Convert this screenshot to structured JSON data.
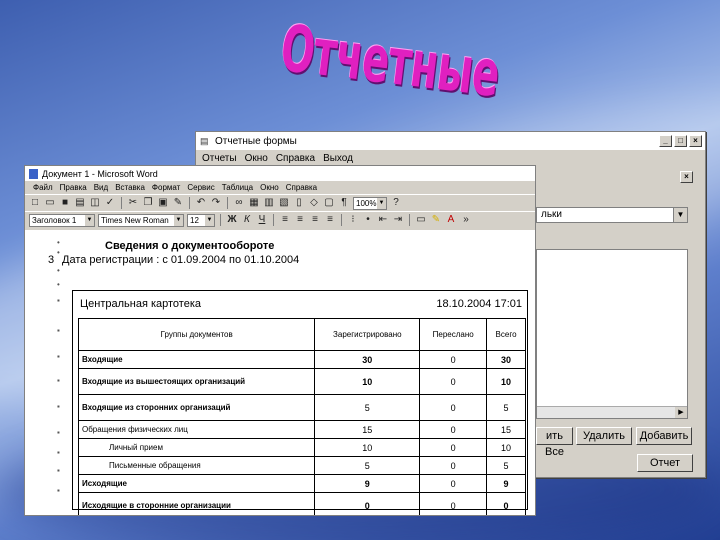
{
  "slide": {
    "title": "Отчетные формы"
  },
  "back_window": {
    "title": "Отчетные формы",
    "menu": [
      "Отчеты",
      "Окно",
      "Справка",
      "Выход"
    ],
    "combo_value": "льки",
    "buttons": {
      "save": "ить Все",
      "delete": "Удалить",
      "add": "Добавить",
      "report": "Отчет"
    }
  },
  "word_window": {
    "title": "Документ 1 - Microsoft Word",
    "menu": [
      "Файл",
      "Правка",
      "Вид",
      "Вставка",
      "Формат",
      "Сервис",
      "Таблица",
      "Окно",
      "Справка"
    ],
    "style_value": "Заголовок 1",
    "font_value": "Times New Roman",
    "size_value": "12",
    "zoom_value": "100%"
  },
  "document": {
    "heading": "Сведения о документообороте",
    "subheading_prefix": "3",
    "subheading": "Дата регистрации : с 01.09.2004 по 01.10.2004",
    "report": {
      "org": "Центральная картотека",
      "date": "18.10.2004 17:01",
      "columns": [
        "Группы документов",
        "Зарегистрировано",
        "Переслано",
        "Всего"
      ],
      "rows": [
        {
          "name": "Входящие",
          "reg": "30",
          "sent": "0",
          "total": "30"
        },
        {
          "name": "Входящие из вышестоящих организаций",
          "reg": "10",
          "sent": "0",
          "total": "10"
        },
        {
          "name": "Входящие из сторонних организаций",
          "reg": "5",
          "sent": "0",
          "total": "5"
        },
        {
          "name": "Обращения физических лиц",
          "reg": "15",
          "sent": "0",
          "total": "15"
        },
        {
          "name": "Личный прием",
          "reg": "10",
          "sent": "0",
          "total": "10"
        },
        {
          "name": "Письменные обращения",
          "reg": "5",
          "sent": "0",
          "total": "5"
        },
        {
          "name": "Исходящие",
          "reg": "9",
          "sent": "0",
          "total": "9"
        },
        {
          "name": "Исходящие в сторонние организации",
          "reg": "0",
          "sent": "0",
          "total": "0"
        }
      ]
    }
  }
}
